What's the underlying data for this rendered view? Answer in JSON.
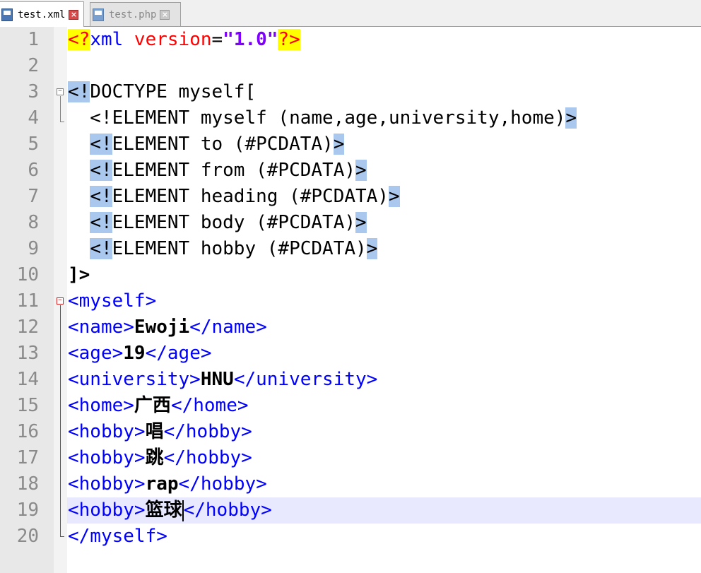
{
  "tabs": [
    {
      "label": "test.xml",
      "active": true
    },
    {
      "label": "test.php",
      "active": false
    }
  ],
  "lines": [
    {
      "num": "1"
    },
    {
      "num": "2"
    },
    {
      "num": "3"
    },
    {
      "num": "4"
    },
    {
      "num": "5"
    },
    {
      "num": "6"
    },
    {
      "num": "7"
    },
    {
      "num": "8"
    },
    {
      "num": "9"
    },
    {
      "num": "10"
    },
    {
      "num": "11"
    },
    {
      "num": "12"
    },
    {
      "num": "13"
    },
    {
      "num": "14"
    },
    {
      "num": "15"
    },
    {
      "num": "16"
    },
    {
      "num": "17"
    },
    {
      "num": "18"
    },
    {
      "num": "19"
    },
    {
      "num": "20"
    }
  ],
  "code": {
    "l1": {
      "pi_open": "<?",
      "xml": "xml",
      "attr": " version",
      "eq": "=",
      "val": "\"1.0\"",
      "pi_close": "?>"
    },
    "l3": {
      "open": "<!",
      "text": "DOCTYPE myself["
    },
    "l4": {
      "text": "  <!ELEMENT myself (name,age,university,home)",
      "close": ">"
    },
    "l5": {
      "open": "<!",
      "text": "ELEMENT to (#PCDATA)",
      "close": ">"
    },
    "l6": {
      "open": "<!",
      "text": "ELEMENT from (#PCDATA)",
      "close": ">"
    },
    "l7": {
      "open": "<!",
      "text": "ELEMENT heading (#PCDATA)",
      "close": ">"
    },
    "l8": {
      "open": "<!",
      "text": "ELEMENT body (#PCDATA)",
      "close": ">"
    },
    "l9": {
      "open": "<!",
      "text": "ELEMENT hobby (#PCDATA)",
      "close": ">"
    },
    "l10": {
      "text": "]>"
    },
    "l11": {
      "tag": "<myself>"
    },
    "l12": {
      "open": "<name>",
      "val": "Ewoji",
      "close": "</name>"
    },
    "l13": {
      "open": "<age>",
      "val": "19",
      "close": "</age>"
    },
    "l14": {
      "open": "<university>",
      "val": "HNU",
      "close": "</university>"
    },
    "l15": {
      "open": "<home>",
      "val": "广西",
      "close": "</home>"
    },
    "l16": {
      "open": "<hobby>",
      "val": "唱",
      "close": "</hobby>"
    },
    "l17": {
      "open": "<hobby>",
      "val": "跳",
      "close": "</hobby>"
    },
    "l18": {
      "open": "<hobby>",
      "val": "rap",
      "close": "</hobby>"
    },
    "l19": {
      "open": "<hobby>",
      "val": "篮球",
      "close": "</hobby>"
    },
    "l20": {
      "tag": "</myself>"
    }
  },
  "colors": {
    "tag": "#0000ff",
    "attribute": "#ff0000",
    "string": "#8000ff",
    "pi_highlight": "#ffff00",
    "selection": "#aac8ee",
    "current_line": "#e8e8ff"
  }
}
